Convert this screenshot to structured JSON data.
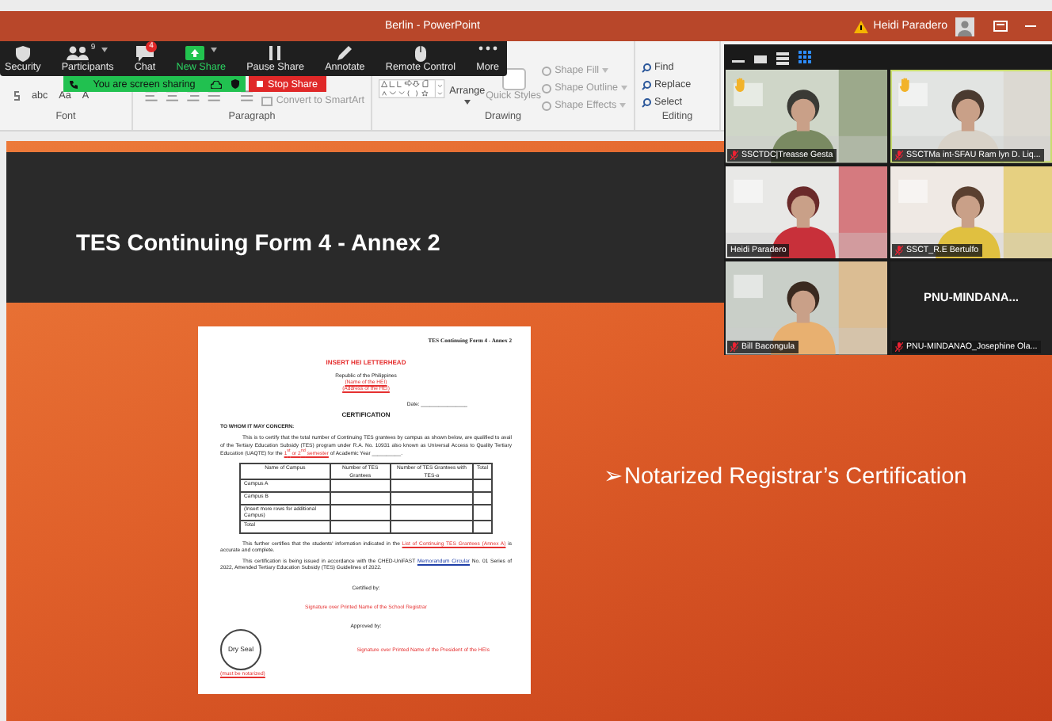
{
  "window": {
    "title": "Berlin  -  PowerPoint",
    "user": "Heidi Paradero"
  },
  "ribbon": {
    "font_buttons": [
      "abc",
      "Aa",
      "A"
    ],
    "paragraph_command": "Convert to SmartArt",
    "arrange": "Arrange",
    "quick_styles": "Quick Styles",
    "shape_commands": [
      "Shape Fill",
      "Shape Outline",
      "Shape Effects"
    ],
    "editing_commands": [
      "Find",
      "Replace",
      "Select"
    ],
    "group_labels": [
      "Font",
      "Paragraph",
      "Drawing",
      "Editing"
    ]
  },
  "meeting_toolbar": {
    "buttons": [
      {
        "kind": "security",
        "label": "Security"
      },
      {
        "kind": "participants",
        "label": "Participants",
        "count": "9"
      },
      {
        "kind": "chat",
        "label": "Chat",
        "badge": "4"
      },
      {
        "kind": "new_share",
        "label": "New Share"
      },
      {
        "kind": "pause",
        "label": "Pause Share"
      },
      {
        "kind": "annotate",
        "label": "Annotate"
      },
      {
        "kind": "remote",
        "label": "Remote Control"
      },
      {
        "kind": "more",
        "label": "More"
      }
    ],
    "sharing_status": "You are screen sharing",
    "stop_label": "Stop Share"
  },
  "slide": {
    "title": "TES Continuing Form 4 - Annex 2",
    "bullet": "➢Notarized Registrar’s Certification",
    "document": {
      "header": "TES Continuing Form 4 - Annex 2",
      "letterhead": "INSERT HEI LETTERHEAD",
      "republic": "Republic of the Philippines",
      "hei_name": "(Name of the HEI)",
      "hei_address": "(Address of the HEI)",
      "date_label": "Date: ________________",
      "heading": "CERTIFICATION",
      "salutation": "TO WHOM IT MAY CONCERN:",
      "paragraphs": [
        {
          "parts": [
            {
              "kind": "plain",
              "text": "This is to certify that the total number of Continuing TES grantees by campus as shown below, are qualified to avail of the Tertiary Education Subsidy (TES) program under R.A. No. 10931 also known as Universal Access to Quality Tertiary Education (UAQTE) for the "
            },
            {
              "kind": "red",
              "text": "1$^{st}$ or 2$^{nd}$ semester"
            },
            {
              "kind": "plain",
              "text": " of Academic Year __________."
            }
          ]
        },
        {
          "parts": [
            {
              "kind": "plain",
              "text": "This further certifies that the students' information indicated in the "
            },
            {
              "kind": "red",
              "text": "List of Continuing TES Grantees (Annex A)"
            },
            {
              "kind": "plain",
              "text": " is accurate and complete."
            }
          ]
        },
        {
          "parts": [
            {
              "kind": "plain",
              "text": "This certification is being issued in accordance with the CHED-UniFAST "
            },
            {
              "kind": "link",
              "text": "Memorandum Circular"
            },
            {
              "kind": "plain",
              "text": " No. 01 Series of 2022, Amended Tertiary Education Subsidy (TES) Guidelines of 2022."
            }
          ]
        }
      ],
      "table": {
        "columns": [
          "Name of Campus",
          "Number of TES Grantees",
          "Number of TES Grantees with TES-a",
          "Total"
        ],
        "rows": [
          "Campus A",
          "Campus B",
          "(Insert more rows for additional Campus)",
          "Total"
        ]
      },
      "certified_by": "Certified by:",
      "registrar_signature": "Signature over Printed Name of the School Registrar",
      "approved_by": "Approved by:",
      "seal": "Dry Seal",
      "president_signature": "Signature over Printed Name of the President of the HEIs",
      "notarized": "(must be notarized)"
    }
  },
  "video_panel": {
    "view_buttons": [
      {
        "kind": "minimize",
        "selected": false
      },
      {
        "kind": "speaker",
        "selected": false
      },
      {
        "kind": "strip",
        "selected": false
      },
      {
        "kind": "gallery",
        "selected": true
      }
    ],
    "participants": [
      {
        "kind": "video",
        "name": "SSCTDC|Treasse Gesta",
        "muted": true,
        "hand_raised": true,
        "speaking": false
      },
      {
        "kind": "video",
        "name": "SSCTMa int-SFAU Ram lyn D. Liq...",
        "muted": true,
        "hand_raised": true,
        "speaking": true
      },
      {
        "kind": "video",
        "name": "Heidi Paradero",
        "muted": false,
        "hand_raised": false,
        "speaking": false
      },
      {
        "kind": "video",
        "name": "SSCT_R.E Bertulfo",
        "muted": true,
        "hand_raised": false,
        "speaking": false
      },
      {
        "kind": "video",
        "name": "Bill Bacongula",
        "muted": true,
        "hand_raised": false,
        "speaking": false
      },
      {
        "kind": "name_only",
        "label": "PNU-MINDANA...",
        "name": "PNU-MINDANAO_Josephine Ola...",
        "muted": true,
        "hand_raised": false,
        "speaking": false
      }
    ]
  }
}
